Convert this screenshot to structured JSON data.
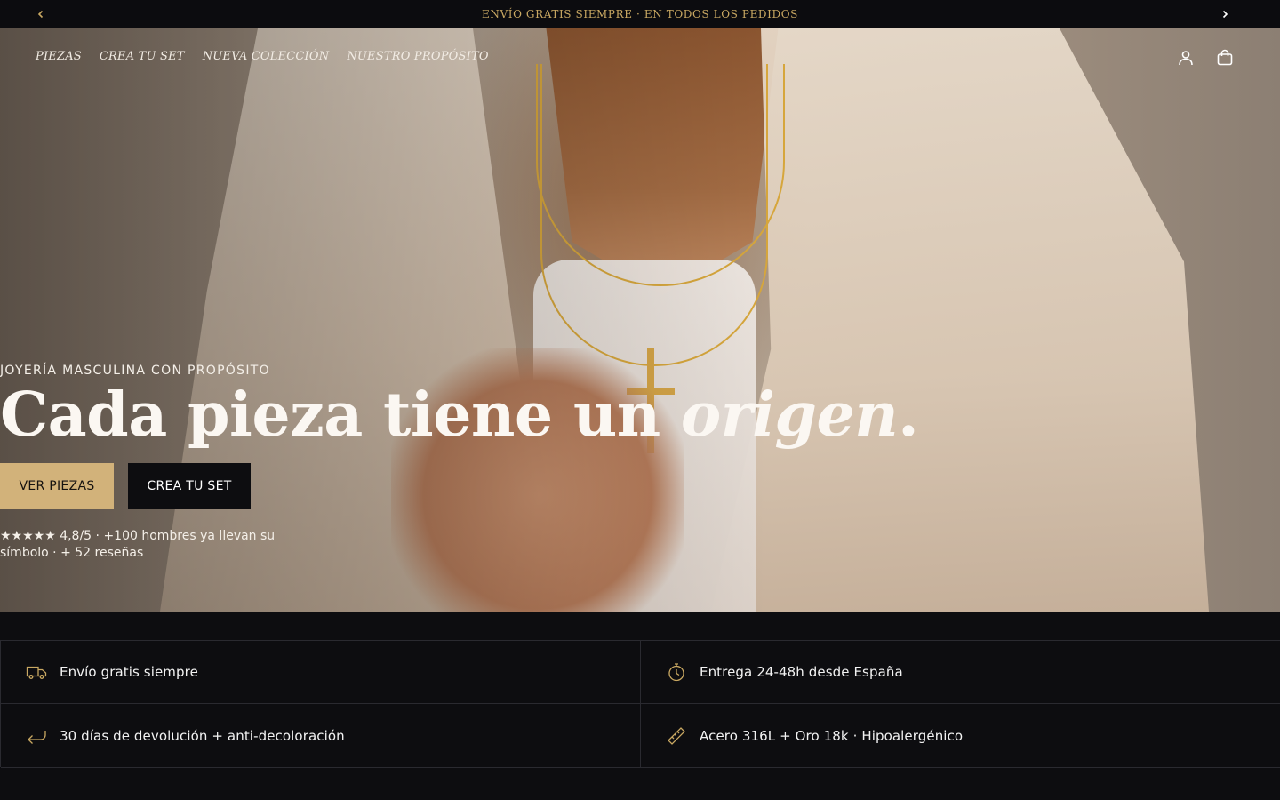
{
  "announcement": {
    "text": "ENVÍO GRATIS SIEMPRE · EN TODOS LOS PEDIDOS",
    "prev_icon": "chevron-left-icon",
    "next_icon": "chevron-right-icon"
  },
  "nav": {
    "items": [
      {
        "label": "PIEZAS"
      },
      {
        "label": "CREA TU SET"
      },
      {
        "label": "NUEVA COLECCIÓN"
      },
      {
        "label": "NUESTRO PROPÓSITO"
      }
    ],
    "icons": [
      "user-icon",
      "shopping-bag-icon"
    ]
  },
  "hero": {
    "eyebrow": "JOYERÍA MASCULINA CON PROPÓSITO",
    "headline_main": "Cada pieza tiene un ",
    "headline_emphasis": "origen",
    "headline_end": ".",
    "primary_cta": "VER PIEZAS",
    "secondary_cta": "CREA TU SET",
    "rating_text": "★★★★★ 4,8/5 · +100 hombres ya llevan su símbolo · + 52 reseñas"
  },
  "features": [
    {
      "icon": "truck-icon",
      "label": "Envío gratis siempre"
    },
    {
      "icon": "stopwatch-icon",
      "label": "Entrega 24-48h desde España"
    },
    {
      "icon": "return-arrow-icon",
      "label": "30 días de devolución + anti-decoloración"
    },
    {
      "icon": "ruler-icon",
      "label": "Acero 316L + Oro 18k · Hipoalergénico"
    }
  ],
  "colors": {
    "accent_gold": "#d2b27a",
    "announcement_text": "#c9a862",
    "dark_bg": "#0d0d10"
  }
}
